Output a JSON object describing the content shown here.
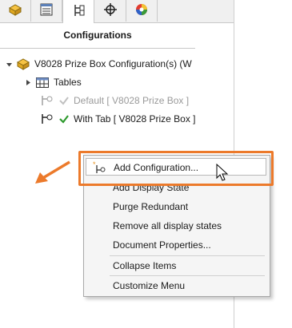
{
  "panel": {
    "title": "Configurations",
    "tabs": [
      {
        "name": "feature-manager-tab",
        "icon": "part-icon"
      },
      {
        "name": "property-manager-tab",
        "icon": "property-list-icon"
      },
      {
        "name": "configuration-manager-tab",
        "icon": "configuration-tree-icon",
        "active": true
      },
      {
        "name": "dimxpert-tab",
        "icon": "crosshair-icon"
      },
      {
        "name": "display-manager-tab",
        "icon": "color-wheel-icon"
      }
    ]
  },
  "tree": {
    "root_label": "V8028 Prize Box Configuration(s)  (W",
    "tables_label": "Tables",
    "configs": [
      {
        "label": "Default [ V8028 Prize Box ]",
        "active": false
      },
      {
        "label": "With Tab [ V8028 Prize Box ]",
        "active": true
      }
    ]
  },
  "context_menu": {
    "items": [
      {
        "label": "Add Configuration...",
        "highlighted": true
      },
      {
        "label": "Add Display State"
      },
      {
        "label": "Purge Redundant"
      },
      {
        "label": "Remove all display states"
      },
      {
        "label": "Document Properties..."
      },
      {
        "label": "Collapse Items"
      },
      {
        "label": "Customize Menu"
      }
    ]
  },
  "colors": {
    "highlight": "#ec7a2b",
    "check_green": "#2e9a2e",
    "muted_text": "#9a9a9a"
  }
}
